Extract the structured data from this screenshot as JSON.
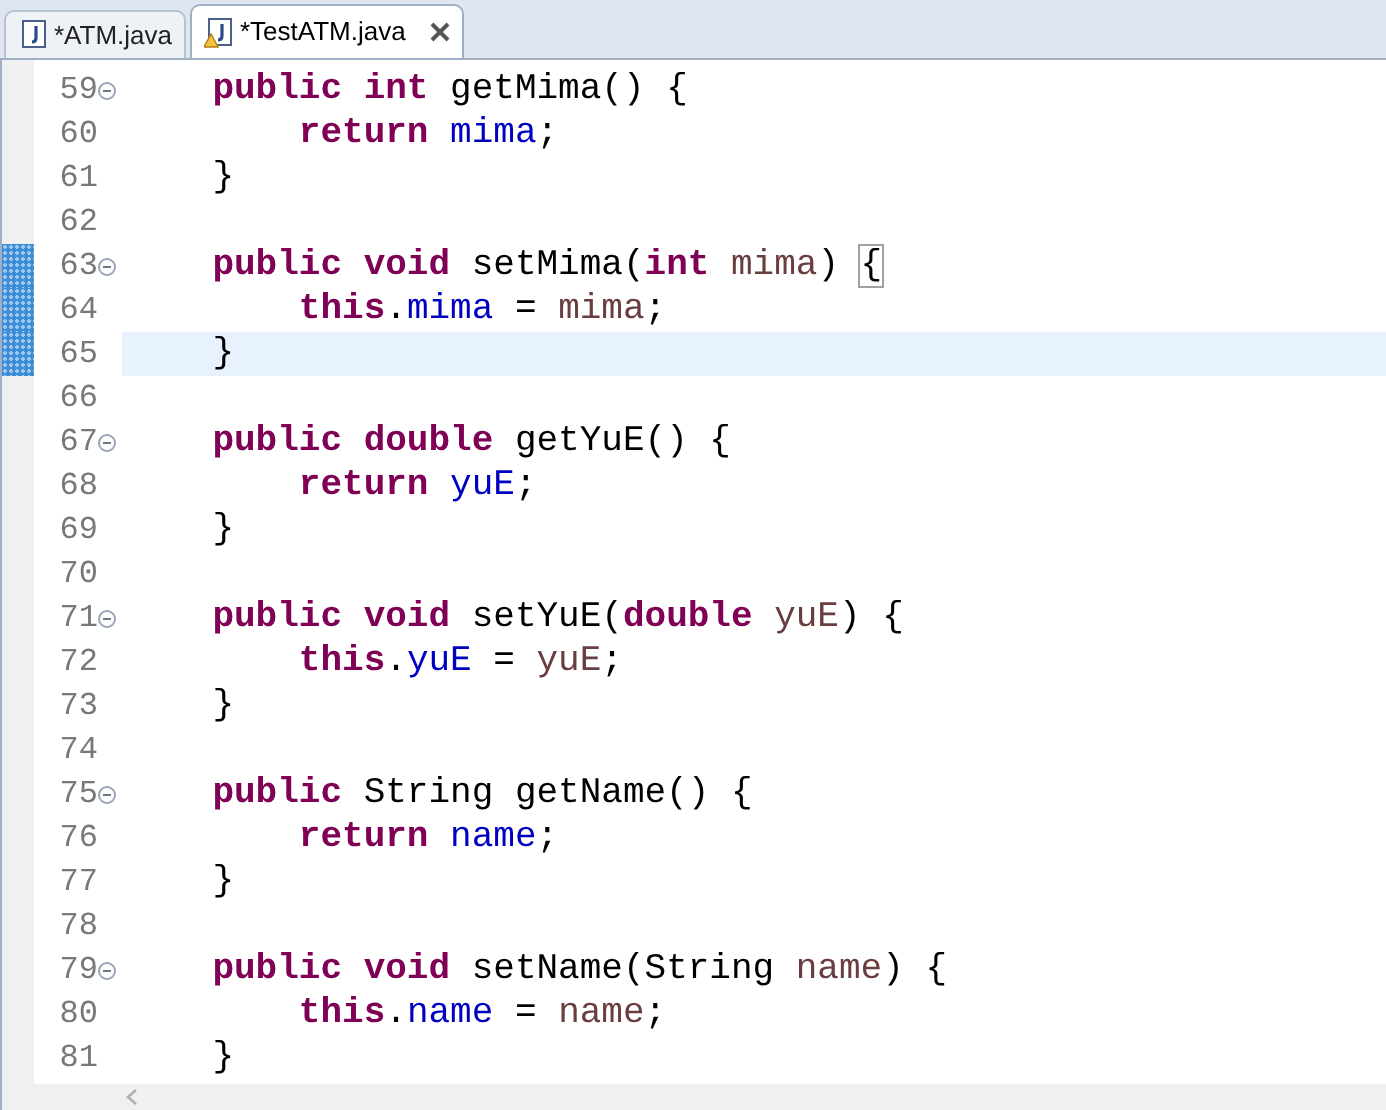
{
  "tabs": [
    {
      "label": "*ATM.java",
      "selected": false,
      "warning": false
    },
    {
      "label": "*TestATM.java",
      "selected": true,
      "warning": true
    }
  ],
  "editor": {
    "lines": [
      {
        "number": "59",
        "fold": true,
        "changed": false,
        "current": false,
        "tokens": [
          {
            "kind": "keyword",
            "text": "    public"
          },
          {
            "kind": "keyword",
            "text": " int"
          },
          {
            "kind": "plain",
            "text": " getMima() {"
          }
        ]
      },
      {
        "number": "60",
        "fold": false,
        "changed": false,
        "current": false,
        "tokens": [
          {
            "kind": "keyword",
            "text": "        return"
          },
          {
            "kind": "field",
            "text": " mima"
          },
          {
            "kind": "plain",
            "text": ";"
          }
        ]
      },
      {
        "number": "61",
        "fold": false,
        "changed": false,
        "current": false,
        "tokens": [
          {
            "kind": "plain",
            "text": "    }"
          }
        ]
      },
      {
        "number": "62",
        "fold": false,
        "changed": false,
        "current": false
      },
      {
        "number": "63",
        "fold": true,
        "changed": true,
        "current": false,
        "tokens": [
          {
            "kind": "keyword",
            "text": "    public"
          },
          {
            "kind": "keyword",
            "text": " void"
          },
          {
            "kind": "plain",
            "text": " setMima("
          },
          {
            "kind": "keyword",
            "text": "int"
          },
          {
            "kind": "param",
            "text": " mima"
          },
          {
            "kind": "plain",
            "text": ") "
          },
          {
            "kind": "bracket",
            "text": "{"
          }
        ]
      },
      {
        "number": "64",
        "fold": false,
        "changed": true,
        "current": false,
        "tokens": [
          {
            "kind": "keyword",
            "text": "        this"
          },
          {
            "kind": "plain",
            "text": "."
          },
          {
            "kind": "field",
            "text": "mima"
          },
          {
            "kind": "plain",
            "text": " ="
          },
          {
            "kind": "param",
            "text": " mima"
          },
          {
            "kind": "plain",
            "text": ";"
          }
        ]
      },
      {
        "number": "65",
        "fold": false,
        "changed": true,
        "current": true,
        "tokens": [
          {
            "kind": "plain",
            "text": "    }"
          }
        ]
      },
      {
        "number": "66",
        "fold": false,
        "changed": false,
        "current": false
      },
      {
        "number": "67",
        "fold": true,
        "changed": false,
        "current": false,
        "tokens": [
          {
            "kind": "keyword",
            "text": "    public"
          },
          {
            "kind": "keyword",
            "text": " double"
          },
          {
            "kind": "plain",
            "text": " getYuE() {"
          }
        ]
      },
      {
        "number": "68",
        "fold": false,
        "changed": false,
        "current": false,
        "tokens": [
          {
            "kind": "keyword",
            "text": "        return"
          },
          {
            "kind": "field",
            "text": " yuE"
          },
          {
            "kind": "plain",
            "text": ";"
          }
        ]
      },
      {
        "number": "69",
        "fold": false,
        "changed": false,
        "current": false,
        "tokens": [
          {
            "kind": "plain",
            "text": "    }"
          }
        ]
      },
      {
        "number": "70",
        "fold": false,
        "changed": false,
        "current": false
      },
      {
        "number": "71",
        "fold": true,
        "changed": false,
        "current": false,
        "tokens": [
          {
            "kind": "keyword",
            "text": "    public"
          },
          {
            "kind": "keyword",
            "text": " void"
          },
          {
            "kind": "plain",
            "text": " setYuE("
          },
          {
            "kind": "keyword",
            "text": "double"
          },
          {
            "kind": "param",
            "text": " yuE"
          },
          {
            "kind": "plain",
            "text": ") {"
          }
        ]
      },
      {
        "number": "72",
        "fold": false,
        "changed": false,
        "current": false,
        "tokens": [
          {
            "kind": "keyword",
            "text": "        this"
          },
          {
            "kind": "plain",
            "text": "."
          },
          {
            "kind": "field",
            "text": "yuE"
          },
          {
            "kind": "plain",
            "text": " ="
          },
          {
            "kind": "param",
            "text": " yuE"
          },
          {
            "kind": "plain",
            "text": ";"
          }
        ]
      },
      {
        "number": "73",
        "fold": false,
        "changed": false,
        "current": false,
        "tokens": [
          {
            "kind": "plain",
            "text": "    }"
          }
        ]
      },
      {
        "number": "74",
        "fold": false,
        "changed": false,
        "current": false
      },
      {
        "number": "75",
        "fold": true,
        "changed": false,
        "current": false,
        "tokens": [
          {
            "kind": "keyword",
            "text": "    public"
          },
          {
            "kind": "plain",
            "text": " String getName() {"
          }
        ]
      },
      {
        "number": "76",
        "fold": false,
        "changed": false,
        "current": false,
        "tokens": [
          {
            "kind": "keyword",
            "text": "        return"
          },
          {
            "kind": "field",
            "text": " name"
          },
          {
            "kind": "plain",
            "text": ";"
          }
        ]
      },
      {
        "number": "77",
        "fold": false,
        "changed": false,
        "current": false,
        "tokens": [
          {
            "kind": "plain",
            "text": "    }"
          }
        ]
      },
      {
        "number": "78",
        "fold": false,
        "changed": false,
        "current": false
      },
      {
        "number": "79",
        "fold": true,
        "changed": false,
        "current": false,
        "tokens": [
          {
            "kind": "keyword",
            "text": "    public"
          },
          {
            "kind": "keyword",
            "text": " void"
          },
          {
            "kind": "plain",
            "text": " setName(String"
          },
          {
            "kind": "param",
            "text": " name"
          },
          {
            "kind": "plain",
            "text": ") {"
          }
        ]
      },
      {
        "number": "80",
        "fold": false,
        "changed": false,
        "current": false,
        "tokens": [
          {
            "kind": "keyword",
            "text": "        this"
          },
          {
            "kind": "plain",
            "text": "."
          },
          {
            "kind": "field",
            "text": "name"
          },
          {
            "kind": "plain",
            "text": " ="
          },
          {
            "kind": "param",
            "text": " name"
          },
          {
            "kind": "plain",
            "text": ";"
          }
        ]
      },
      {
        "number": "81",
        "fold": false,
        "changed": false,
        "current": false,
        "tokens": [
          {
            "kind": "plain",
            "text": "    }"
          }
        ]
      }
    ]
  }
}
